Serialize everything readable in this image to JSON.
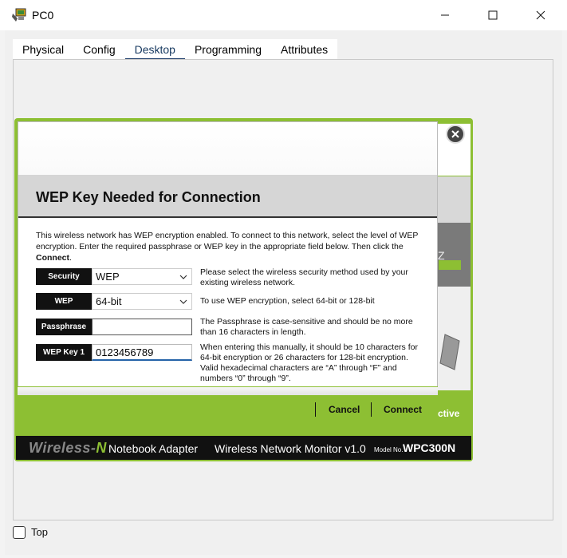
{
  "window": {
    "title": "PC0",
    "app_icon": "pc-icon",
    "controls": {
      "minimize": "minimize-icon",
      "maximize": "maximize-icon",
      "close": "close-icon"
    }
  },
  "tabs": [
    {
      "label": "Physical",
      "active": false
    },
    {
      "label": "Config",
      "active": false
    },
    {
      "label": "Desktop",
      "active": true
    },
    {
      "label": "Programming",
      "active": false
    },
    {
      "label": "Attributes",
      "active": false
    }
  ],
  "background_app": {
    "partial_text_z": "Z",
    "partial_text_active": "ctive",
    "close_icon": "close-circle-icon",
    "footer": {
      "brand_prefix": "Wireless-",
      "brand_n": "N",
      "adapter": "Notebook Adapter",
      "monitor": "Wireless Network Monitor  v1.0",
      "model_no_label": "Model No.",
      "model": "WPC300N"
    }
  },
  "dialog": {
    "title": "WEP Key Needed for Connection",
    "description_pre": "This wireless network has WEP encryption enabled. To connect to this network, select the level of WEP encryption. Enter the required passphrase or WEP key in the appropriate field below. Then click the ",
    "description_bold": "Connect",
    "description_post": ".",
    "security": {
      "label": "Security",
      "value": "WEP",
      "hint": "Please select the wireless security method used by your existing wireless network."
    },
    "wep": {
      "label": "WEP",
      "value": "64-bit",
      "hint": "To use WEP encryption, select 64-bit or 128-bit"
    },
    "passphrase": {
      "label": "Passphrase",
      "value": "",
      "hint": "The Passphrase is case-sensitive and should be no more than 16 characters in length."
    },
    "wep_key_1": {
      "label": "WEP Key 1",
      "value": "0123456789",
      "hint": "When entering this manually, it should be 10 characters for 64-bit encryption or 26 characters for 128-bit encryption. Valid hexadecimal characters are “A” through “F” and numbers “0”  through “9”."
    },
    "buttons": {
      "cancel": "Cancel",
      "connect": "Connect"
    }
  },
  "footer_window": {
    "top_label": "Top",
    "top_checked": false
  }
}
